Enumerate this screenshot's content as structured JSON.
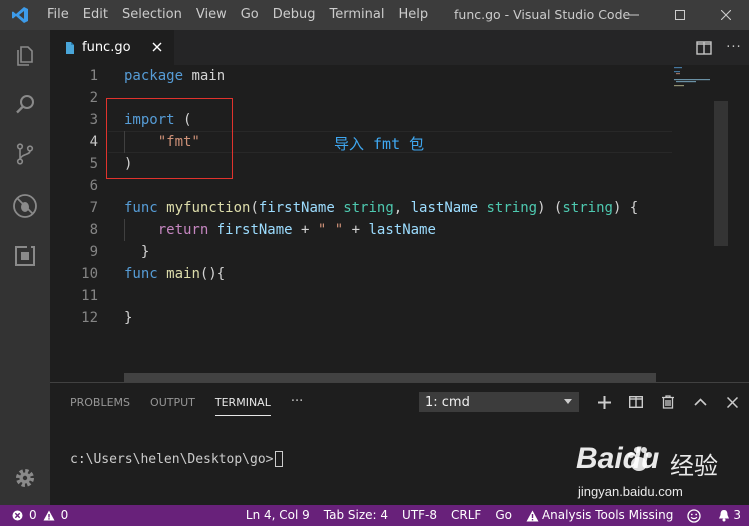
{
  "window": {
    "title": "func.go - Visual Studio Code",
    "menu": [
      "File",
      "Edit",
      "Selection",
      "View",
      "Go",
      "Debug",
      "Terminal",
      "Help"
    ]
  },
  "activity_bar": {
    "items": [
      "explorer-icon",
      "search-icon",
      "source-control-icon",
      "debug-icon",
      "extensions-icon"
    ],
    "bottom": "gear-icon"
  },
  "tabs": [
    {
      "label": "func.go",
      "icon": "go-file-icon",
      "active": true
    }
  ],
  "editor": {
    "line_numbers": [
      "1",
      "2",
      "3",
      "4",
      "5",
      "6",
      "7",
      "8",
      "9",
      "10",
      "11",
      "12"
    ],
    "active_line": 4,
    "lines": [
      {
        "t1": "package",
        "t2": " main"
      },
      {},
      {
        "t1": "import",
        "t2": " ("
      },
      {
        "t1": "    ",
        "t2": "\"fmt\""
      },
      {
        "t1": ")"
      },
      {},
      {
        "kw": "func",
        "fn": "myfunction",
        "p": "(",
        "a1": "firstName",
        "ty1": "string",
        "c": ", ",
        "a2": "lastName",
        "ty2": "string",
        "e": ") (",
        "ty3": "string",
        "z": ") {"
      },
      {
        "kw": "return",
        "a1": "firstName",
        "plus1": " + ",
        "s": "\" \"",
        "plus2": " + ",
        "a2": "lastName"
      },
      {
        "t1": "  }"
      },
      {
        "kw": "func",
        "fn": "main",
        "p": "(){"
      },
      {},
      {
        "t1": "}"
      }
    ],
    "annotation": "导入 fmt 包",
    "accent_box_color": "#e0332d"
  },
  "panel": {
    "tabs": [
      "PROBLEMS",
      "OUTPUT",
      "TERMINAL"
    ],
    "active_tab": "TERMINAL",
    "more": "···",
    "terminal_select": "1: cmd",
    "terminal_prompt": "c:\\Users\\helen\\Desktop\\go>"
  },
  "status_bar": {
    "errors": "0",
    "warnings": "0",
    "cursor": "Ln 4, Col 9",
    "tab_size": "Tab Size: 4",
    "encoding": "UTF-8",
    "eol": "CRLF",
    "language": "Go",
    "tools": "Analysis Tools Missing",
    "notifications": "3",
    "color": "#68217a"
  },
  "watermark": {
    "brand": "Baidu",
    "cn": "经验",
    "url": "jingyan.baidu.com"
  }
}
